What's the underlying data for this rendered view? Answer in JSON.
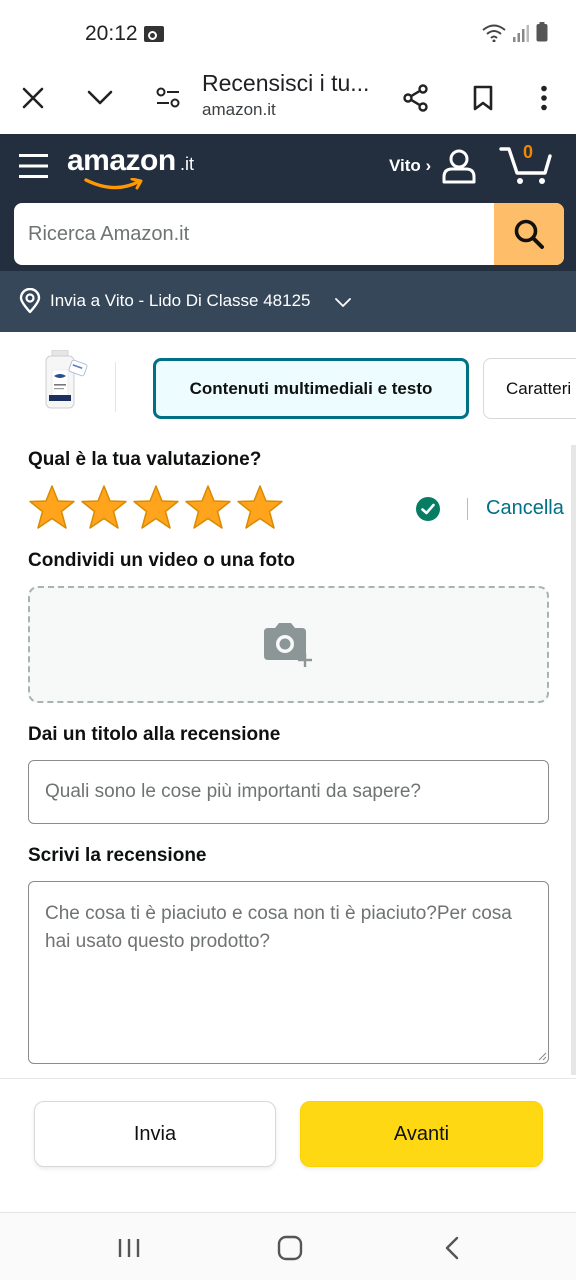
{
  "colors": {
    "header_bg": "#232f3e",
    "deliver_bg": "#37475a",
    "search_button": "#febd69",
    "accent_teal": "#007185",
    "primary_button": "#ffd814",
    "star": "#ffa41c",
    "check": "#067d62",
    "cart_count": "#f08804"
  },
  "status_bar": {
    "time": "20:12",
    "icons": [
      "key-icon",
      "wifi-icon",
      "signal-icon",
      "battery-icon"
    ]
  },
  "browser": {
    "title": "Recensisci i tu...",
    "domain": "amazon.it",
    "icons": [
      "close-icon",
      "chevron-down-icon",
      "page-settings-icon",
      "share-icon",
      "bookmark-icon",
      "more-icon"
    ]
  },
  "amazon_header": {
    "logo": "amazon",
    "logo_suffix": ".it",
    "user_label": "Vito ›",
    "cart_count": "0",
    "search_placeholder": "Ricerca Amazon.it",
    "deliver_to": "Invia a Vito - Lido Di Classe 48125"
  },
  "tabs": [
    {
      "label": "Contenuti multimediali e testo",
      "active": true
    },
    {
      "label": "Caratteri",
      "active": false
    }
  ],
  "review": {
    "rating_question": "Qual è la tua valutazione?",
    "rating_stars": 5,
    "rating_max": 5,
    "cancel_label": "Cancella",
    "media_label": "Condividi un video o una foto",
    "title_label": "Dai un titolo alla recensione",
    "title_placeholder": "Quali sono le cose più importanti da sapere?",
    "body_label": "Scrivi la recensione",
    "body_placeholder": "Che cosa ti è piaciuto e cosa non ti è piaciuto?Per cosa hai usato questo prodotto?"
  },
  "actions": {
    "submit_label": "Invia",
    "next_label": "Avanti"
  },
  "system_nav": {
    "icons": [
      "recent-apps-icon",
      "home-icon",
      "back-icon"
    ]
  }
}
